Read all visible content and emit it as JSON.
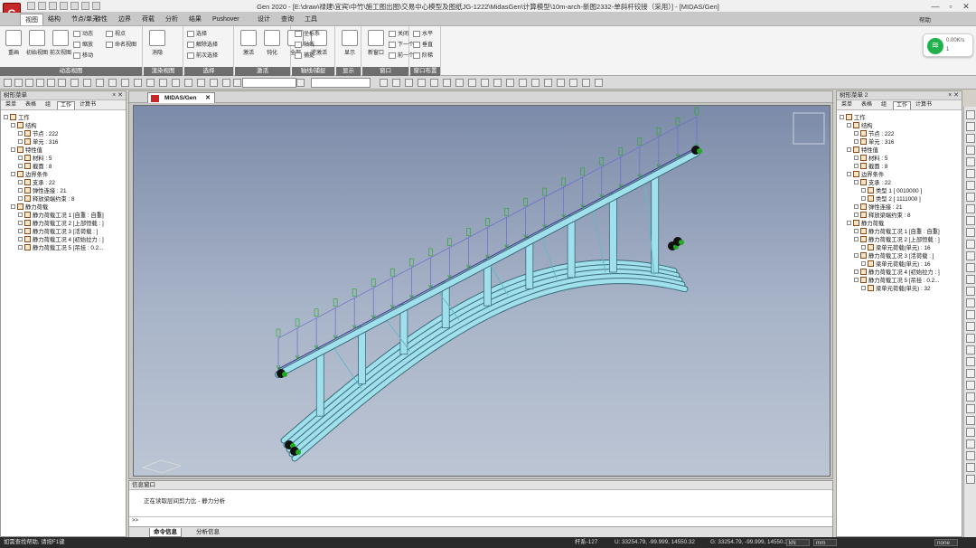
{
  "titlebar": {
    "title": "Gen 2020 - [E:\\draw\\禄建\\宜宾\\中竹\\施工图出图\\交易中心模型及图纸JG-1222\\MidasGen\\计算模型\\10m-arch-新图2332-单斜杆铰接（采用）] - [MIDAS/Gen]",
    "minimize": "—",
    "restore": "▫",
    "close": "✕"
  },
  "app_logo": "G",
  "menubar": {
    "items": [
      "视图",
      "结构",
      "节点/单元",
      "特性",
      "边界",
      "荷载",
      "分析",
      "结果",
      "Pushover",
      "设计",
      "查询",
      "工具"
    ],
    "active": 0,
    "help": "帮助"
  },
  "ribbon": {
    "groups": [
      {
        "label": "动态视图",
        "big": [
          "重画",
          "初始视图",
          "前次视图"
        ],
        "small": [
          "动态",
          "缩放",
          "移动",
          "视点",
          "命名视图"
        ]
      },
      {
        "label": "渲染视图",
        "big": [
          "消隐"
        ],
        "small": []
      },
      {
        "label": "选择",
        "big": [],
        "small": [
          "选择",
          "解除选择",
          "前次选择"
        ]
      },
      {
        "label": "激活",
        "big": [
          "激活",
          "钝化",
          "全部",
          "逆激活"
        ],
        "small": []
      },
      {
        "label": "轴线/捕捉",
        "big": [],
        "small": [
          "坐标系",
          "轴线",
          "捕捉"
        ]
      },
      {
        "label": "显示",
        "big": [
          "显示"
        ],
        "small": []
      },
      {
        "label": "窗口",
        "big": [
          "新窗口"
        ],
        "small": [
          "关闭",
          "下一个",
          "前一个"
        ]
      },
      {
        "label": "窗口布置",
        "big": [],
        "small": [
          "水平",
          "垂直",
          "阶梯"
        ]
      }
    ]
  },
  "network": {
    "speed": "0.00K/s",
    "line2": "1"
  },
  "left_panel": {
    "title": "树形菜单",
    "tabs": [
      "菜单",
      "表格",
      "组",
      "工作",
      "计算书"
    ],
    "active_tab": 3,
    "rows": [
      {
        "t": "工作",
        "d": 0
      },
      {
        "t": "结构",
        "d": 1
      },
      {
        "t": "节点 : 222",
        "d": 2
      },
      {
        "t": "单元 : 316",
        "d": 2
      },
      {
        "t": "特性值",
        "d": 1
      },
      {
        "t": "材料 : 5",
        "d": 2
      },
      {
        "t": "截面 : 8",
        "d": 2
      },
      {
        "t": "边界条件",
        "d": 1
      },
      {
        "t": "支承 : 22",
        "d": 2
      },
      {
        "t": "弹性连接 : 21",
        "d": 2
      },
      {
        "t": "释放梁端约束 : 8",
        "d": 2
      },
      {
        "t": "静力荷载",
        "d": 1
      },
      {
        "t": "静力荷载工况 1 [自重 : 自重]",
        "d": 2
      },
      {
        "t": "静力荷载工况 2 [上部恒载 : ]",
        "d": 2
      },
      {
        "t": "静力荷载工况 3 [活荷载 : ]",
        "d": 2
      },
      {
        "t": "静力荷载工况 4 [初始拉力 : ]",
        "d": 2
      },
      {
        "t": "静力荷载工况 5 [吊挂 : 0.2...",
        "d": 2
      }
    ]
  },
  "right_panel": {
    "title": "树形菜单 2",
    "tabs": [
      "菜单",
      "表格",
      "组",
      "工作",
      "计算书"
    ],
    "active_tab": 3,
    "rows": [
      {
        "t": "工作",
        "d": 0
      },
      {
        "t": "结构",
        "d": 1
      },
      {
        "t": "节点 : 222",
        "d": 2
      },
      {
        "t": "单元 : 316",
        "d": 2
      },
      {
        "t": "特性值",
        "d": 1
      },
      {
        "t": "材料 : 5",
        "d": 2
      },
      {
        "t": "截面 : 8",
        "d": 2
      },
      {
        "t": "边界条件",
        "d": 1
      },
      {
        "t": "支承 : 22",
        "d": 2
      },
      {
        "t": "类型 1 [ 0010000 ]",
        "d": 3
      },
      {
        "t": "类型 2 [ 1111000 ]",
        "d": 3
      },
      {
        "t": "弹性连接 : 21",
        "d": 2
      },
      {
        "t": "释放梁端约束 : 8",
        "d": 2
      },
      {
        "t": "静力荷载",
        "d": 1
      },
      {
        "t": "静力荷载工况 1 [自重 : 自重]",
        "d": 2
      },
      {
        "t": "静力荷载工况 2 [上部恒载 : ]",
        "d": 2
      },
      {
        "t": "梁单元荷载(单元) : 16",
        "d": 3
      },
      {
        "t": "静力荷载工况 3 [活荷载 : ]",
        "d": 2
      },
      {
        "t": "梁单元荷载(单元) : 16",
        "d": 3
      },
      {
        "t": "静力荷载工况 4 [初始拉力 : ]",
        "d": 2
      },
      {
        "t": "静力荷载工况 5 [吊挂 : 0.2...",
        "d": 2
      },
      {
        "t": "梁单元荷载(单元) : 32",
        "d": 3
      }
    ]
  },
  "document": {
    "tab": "MIDAS/Gen",
    "close": "✕"
  },
  "message": {
    "title": "信息窗口",
    "line": "正在读取层间剪力比 - 静力分析",
    "prompt": ">>",
    "tabs": [
      "命令信息",
      "分析信息"
    ],
    "active_tab": 0
  },
  "statusbar": {
    "help": "如需查找帮助, 请按F1键",
    "element": "杆系-127",
    "u": "U: 33254.79, -99.999, 14550.32",
    "g": "G: 33254.79, -99.999, 14550.32",
    "unit": "kN",
    "len": "mm",
    "frame": "none"
  },
  "colors": {
    "viewport_top": "#7c8ba9",
    "member": "#9fe0ec",
    "load": "#22aa22",
    "accent": "#c62828"
  }
}
